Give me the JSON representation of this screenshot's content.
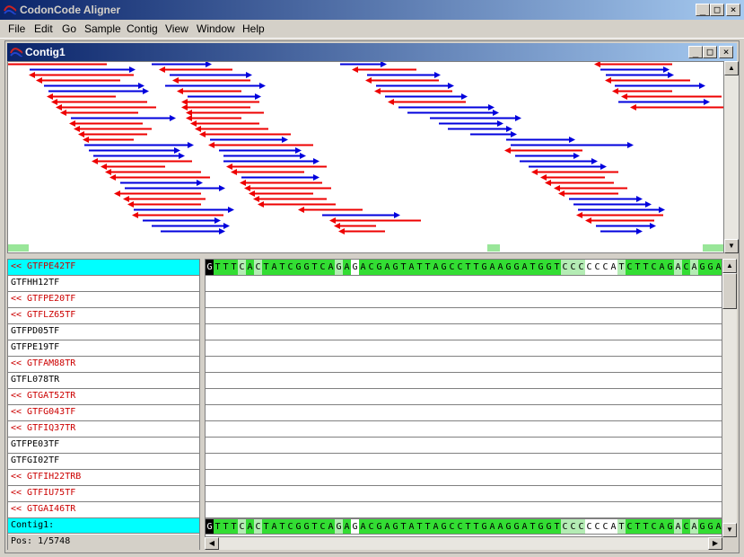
{
  "app": {
    "title": "CodonCode Aligner"
  },
  "menu": [
    {
      "label": "File"
    },
    {
      "label": "Edit"
    },
    {
      "label": "Go"
    },
    {
      "label": "Sample"
    },
    {
      "label": "Contig"
    },
    {
      "label": "View"
    },
    {
      "label": "Window"
    },
    {
      "label": "Help"
    }
  ],
  "contig_window": {
    "title": "Contig1"
  },
  "colors": {
    "forward_read": "#0000dd",
    "reverse_read": "#ee0000",
    "selected_row": "#00ffff",
    "high_quality": "#33dd33",
    "medium_quality": "#b4ecb4",
    "low_quality": "#ffffff",
    "cursor_base": "#000000"
  },
  "reads": [
    {
      "name": "<< GTFPE42TF",
      "reverse": true,
      "selected": true
    },
    {
      "name": "GTFHH12TF",
      "reverse": false
    },
    {
      "name": "<< GTFPE20TF",
      "reverse": true
    },
    {
      "name": "<< GTFLZ65TF",
      "reverse": true
    },
    {
      "name": "GTFPD05TF",
      "reverse": false
    },
    {
      "name": "GTFPE19TF",
      "reverse": false
    },
    {
      "name": "<< GTFAM88TR",
      "reverse": true
    },
    {
      "name": "GTFL078TR",
      "reverse": false
    },
    {
      "name": "<< GTGAT52TR",
      "reverse": true
    },
    {
      "name": "<< GTFG043TF",
      "reverse": true
    },
    {
      "name": "<< GTFIQ37TR",
      "reverse": true
    },
    {
      "name": "GTFPE03TF",
      "reverse": false
    },
    {
      "name": "GTFGI02TF",
      "reverse": false
    },
    {
      "name": "<< GTFIH22TRB",
      "reverse": true
    },
    {
      "name": "<< GTFIU75TF",
      "reverse": true
    },
    {
      "name": "<< GTGAI46TR",
      "reverse": true
    }
  ],
  "sequence": {
    "bases": "GTTTCACTATCGGTCAGAGACGAGTATTAGCCTTGAAGGATGGTCCCCCCATCTTCAGACAGGA",
    "quality": "chhhmhmhhhhhhhhhmhlhhhhhhhhhhhhhhhhhhhhhhhhhmmmllllmhhhhhhmhmhhhh"
  },
  "consensus": {
    "label": "Contig1:"
  },
  "status": {
    "position": "Pos: 1/5748"
  }
}
